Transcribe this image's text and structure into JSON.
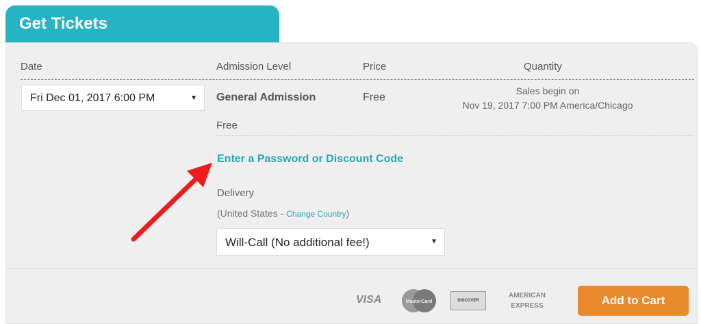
{
  "tab": {
    "title": "Get Tickets"
  },
  "headers": {
    "date": "Date",
    "admission": "Admission Level",
    "price": "Price",
    "quantity": "Quantity"
  },
  "ticket": {
    "date_selected": "Fri Dec 01, 2017 6:00 PM",
    "level": "General Admission",
    "price": "Free",
    "sub_price": "Free",
    "sales_line1": "Sales begin on",
    "sales_line2": "Nov 19, 2017 7:00 PM America/Chicago"
  },
  "discount_link": "Enter a Password or Discount Code",
  "delivery": {
    "label": "Delivery",
    "country_prefix": "(United States - ",
    "change_country": "Change Country",
    "country_suffix": ")",
    "selected": "Will-Call (No additional fee!)"
  },
  "payment": {
    "visa": "VISA",
    "mastercard": "MasterCard",
    "discover": "DISCOVER",
    "amex_line1": "AMERICAN",
    "amex_line2": "EXPRESS"
  },
  "add_to_cart": "Add to Cart",
  "colors": {
    "teal": "#26b3c4",
    "orange": "#e98a2c",
    "arrow_red": "#ee1c1c"
  },
  "icons": {
    "dropdown": "chevron-down-icon",
    "annotation": "red-arrow-icon"
  }
}
